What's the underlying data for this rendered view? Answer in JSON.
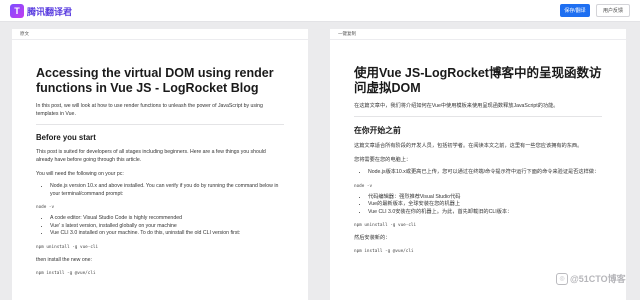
{
  "header": {
    "logo_text": "腾讯翻译君",
    "primary_button": "保存/翻译",
    "secondary_button": "用户反馈"
  },
  "left": {
    "label": "原文",
    "title": "Accessing the virtual DOM using render functions in Vue JS - LogRocket Blog",
    "intro": "In this post, we will look at how to use render functions to unleash the power of JavaScript by using templates in Vue.",
    "section_title": "Before you start",
    "section_para": "This post is suited for developers of all stages including beginners. Here are a few things you should already have before going through this article.",
    "need_text": "You will need the following on your pc:",
    "bullets1": [
      "Node.js version 10.x and above installed. You can verify if you do by running the command below in your terminal/command prompt:"
    ],
    "code1": "node -v",
    "bullets2": [
      "A code editor: Visual Studio Code is highly recommended",
      "Vue' s latest version, installed globally on your machine",
      "Vue CLI 3.0 installed on your machine. To do this, uninstall the old CLI version first:"
    ],
    "code2": "npm uninstall -g vue-cli",
    "then_text": "then install the new one:",
    "code3": "npm install -g @vue/cli"
  },
  "right": {
    "label": "一键复制",
    "title": "使用Vue JS-LogRocket博客中的呈现函数访问虚拟DOM",
    "intro": "在这篇文章中，我们将介绍如何在Vue中使用模板来使用呈现函数释放JavaScript的功能。",
    "section_title": "在你开始之前",
    "section_para": "这篇文章适合所有阶段的开发人员，包括初学者。在阅读本文之前，这里有一些您应该拥有的东西。",
    "need_text": "您将需要在您的电脑上：",
    "bullets1": [
      "Node.js版本10.x或更高已上传，您可以通过在终端/命令提示符中运行下面的命令来验证是否这样做："
    ],
    "code1": "node -v",
    "bullets2": [
      "代码编辑器：强烈推荐Visual Studio代码",
      "Vue的最新版本，全球安装在您的机器上",
      "Vue CLI 3.0安装在你的机器上。为此，首先卸载旧的CLI版本："
    ],
    "code2": "npm uninstall -g vue-cli",
    "then_text": "然后安装新的：",
    "code3": "npm install -g @vue/cli"
  },
  "watermark": {
    "text": "@51CTO博客"
  },
  "colors": {
    "accent": "#1e6ff1",
    "background": "#ebebed"
  }
}
